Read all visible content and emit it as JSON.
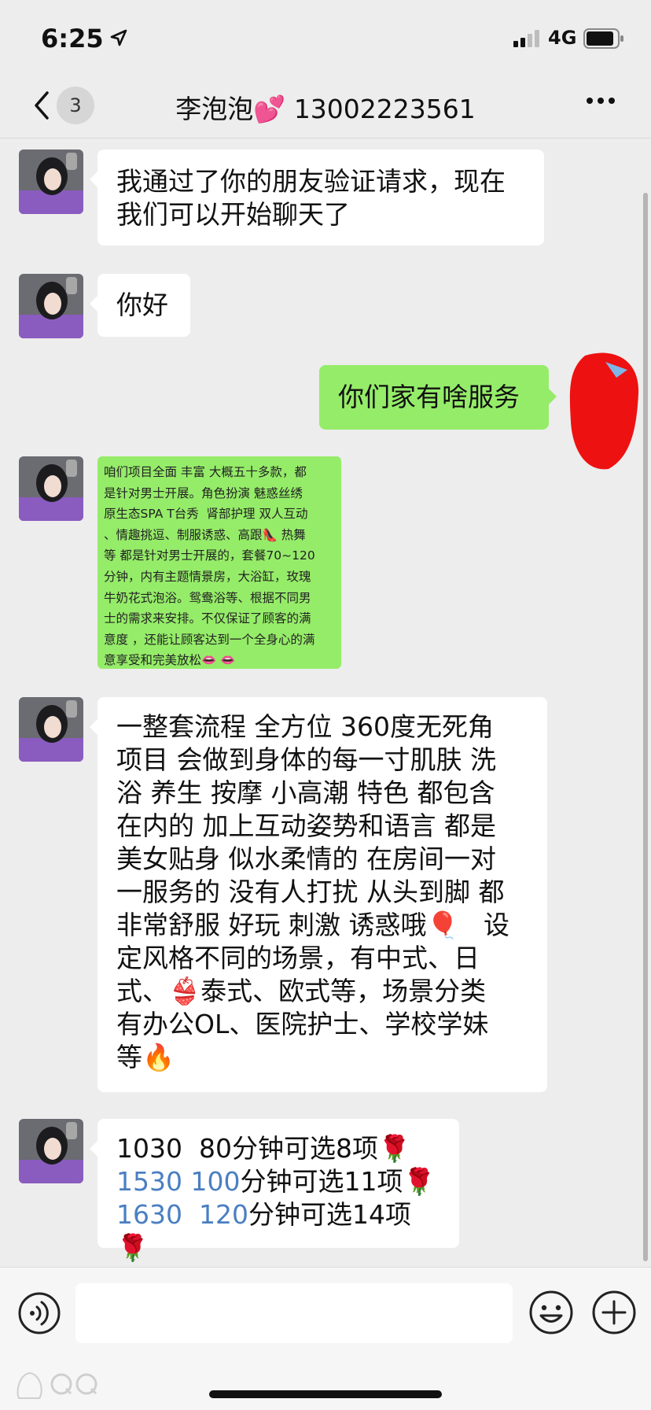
{
  "status_bar": {
    "time": "6:25",
    "network": "4G"
  },
  "nav": {
    "unread_count": "3",
    "title": "李泡泡💕 13002223561"
  },
  "messages": [
    {
      "text": "我通过了你的朋友验证请求，现在\n我们可以开始聊天了"
    },
    {
      "text": "你好"
    },
    {
      "text": "你们家有啥服务"
    },
    {
      "text": "咱们项目全面 丰富 大概五十多款，都\n是针对男士开展。角色扮演 魅惑丝绣\n原生态SPA T台秀  肾部护理 双人互动\n、情趣挑逗、制服诱惑、高跟👠 热舞\n等 都是针对男士开展的，套餐70~120\n分钟，内有主题情景房，大浴缸，玫瑰\n牛奶花式泡浴。鸳鸯浴等、根据不同男\n士的需求来安排。不仅保证了顾客的满\n意度 ，还能让顾客达到一个全身心的满\n意享受和完美放松👄 👄"
    },
    {
      "text": "一整套流程 全方位 360度无死角\n项目 会做到身体的每一寸肌肤 洗\n浴 养生 按摩 小高潮 特色 都包含\n在内的 加上互动姿势和语言 都是\n美女贴身 似水柔情的 在房间一对\n一服务的 没有人打扰 从头到脚 都\n非常舒服 好玩 刺激 诱惑哦🎈   设\n定风格不同的场景，有中式、日\n式、👙泰式、欧式等，场景分类\n有办公OL、医院护士、学校学妹\n等🔥"
    },
    {
      "lines": [
        {
          "highlight": "1030  80",
          "rest": "分钟可选8项🌹"
        },
        {
          "highlight": "1530 100",
          "rest": "分钟可选11项🌹"
        },
        {
          "highlight": "1630  120",
          "rest": "分钟可选14项🌹"
        }
      ]
    }
  ],
  "input": {
    "placeholder": ""
  },
  "colors": {
    "sent_bubble": "#95ec69",
    "received_bubble": "#ffffff",
    "background": "#ededed",
    "link_blue": "#4a7fc1"
  }
}
